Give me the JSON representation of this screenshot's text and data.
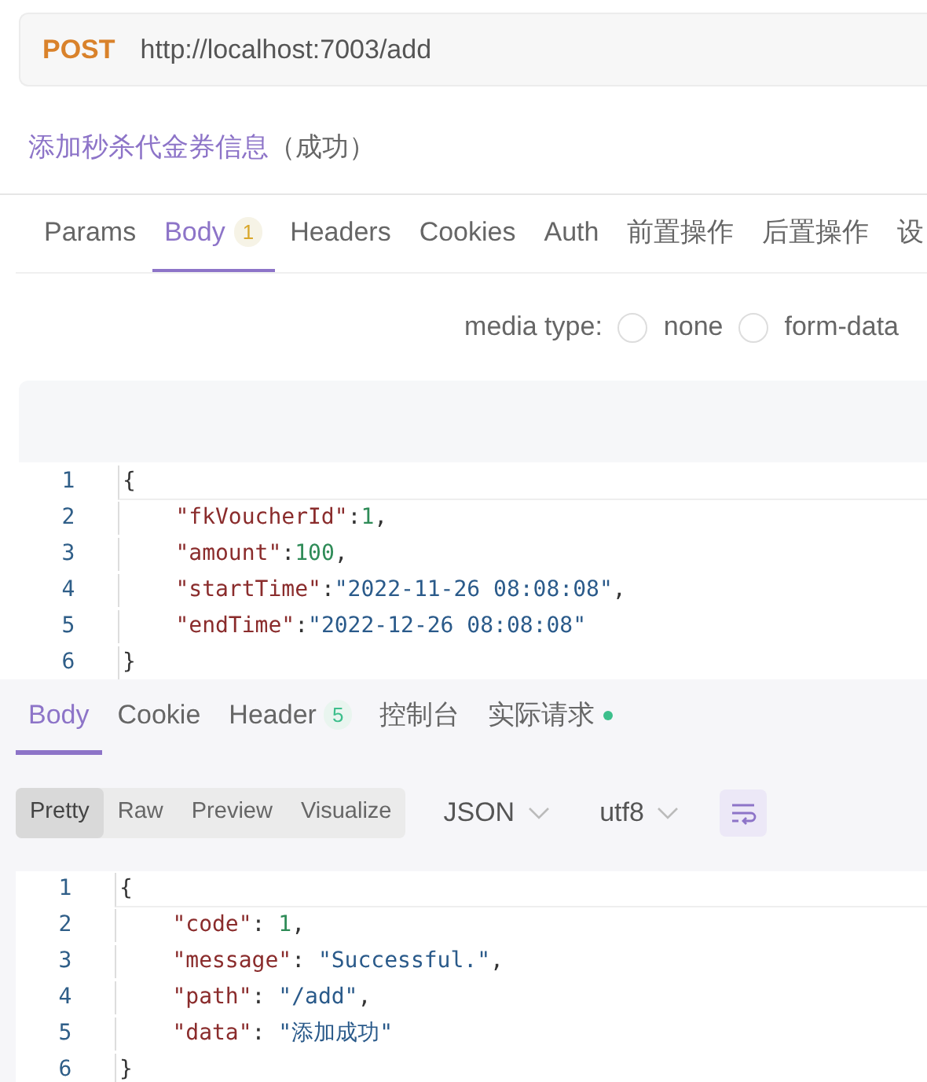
{
  "request": {
    "method": "POST",
    "url": "http://localhost:7003/add"
  },
  "title": {
    "name": "添加秒杀代金券信息",
    "status": "（成功）"
  },
  "request_tabs": [
    {
      "label": "Params",
      "selected": false
    },
    {
      "label": "Body",
      "badge": "1",
      "selected": true
    },
    {
      "label": "Headers",
      "selected": false
    },
    {
      "label": "Cookies",
      "selected": false
    },
    {
      "label": "Auth",
      "selected": false
    },
    {
      "label": "前置操作",
      "selected": false
    },
    {
      "label": "后置操作",
      "selected": false
    },
    {
      "label": "设",
      "selected": false
    }
  ],
  "media_type": {
    "label": "media type:",
    "options": [
      {
        "label": "none",
        "selected": false
      },
      {
        "label": "form-data",
        "selected": false
      }
    ]
  },
  "request_body": [
    {
      "number": "1",
      "tokens": [
        {
          "kind": "punct",
          "text": "{"
        }
      ]
    },
    {
      "number": "2",
      "tokens": [
        {
          "kind": "key",
          "text": "    \"fkVoucherId\""
        },
        {
          "kind": "punct",
          "text": ":"
        },
        {
          "kind": "number",
          "text": "1"
        },
        {
          "kind": "punct",
          "text": ","
        }
      ]
    },
    {
      "number": "3",
      "tokens": [
        {
          "kind": "key",
          "text": "    \"amount\""
        },
        {
          "kind": "punct",
          "text": ":"
        },
        {
          "kind": "number",
          "text": "100"
        },
        {
          "kind": "punct",
          "text": ","
        }
      ]
    },
    {
      "number": "4",
      "tokens": [
        {
          "kind": "key",
          "text": "    \"startTime\""
        },
        {
          "kind": "punct",
          "text": ":"
        },
        {
          "kind": "string",
          "text": "\"2022-11-26 08:08:08\""
        },
        {
          "kind": "punct",
          "text": ","
        }
      ]
    },
    {
      "number": "5",
      "tokens": [
        {
          "kind": "key",
          "text": "    \"endTime\""
        },
        {
          "kind": "punct",
          "text": ":"
        },
        {
          "kind": "string",
          "text": "\"2022-12-26 08:08:08\""
        }
      ]
    },
    {
      "number": "6",
      "tokens": [
        {
          "kind": "punct",
          "text": "}"
        }
      ]
    }
  ],
  "response_tabs": [
    {
      "label": "Body",
      "selected": true
    },
    {
      "label": "Cookie",
      "selected": false
    },
    {
      "label": "Header",
      "badge": "5",
      "selected": false
    },
    {
      "label": "控制台",
      "selected": false
    },
    {
      "label": "实际请求",
      "color": "#3dbf8c",
      "selected": false
    }
  ],
  "view_modes": [
    {
      "label": "Pretty",
      "selected": true
    },
    {
      "label": "Raw",
      "selected": false
    },
    {
      "label": "Preview",
      "selected": false
    },
    {
      "label": "Visualize",
      "selected": false
    }
  ],
  "format": "JSON",
  "encoding": "utf8",
  "response_body": [
    {
      "number": "1",
      "tokens": [
        {
          "kind": "punct",
          "text": "{"
        }
      ]
    },
    {
      "number": "2",
      "tokens": [
        {
          "kind": "key",
          "text": "    \"code\""
        },
        {
          "kind": "punct",
          "text": ": "
        },
        {
          "kind": "number",
          "text": "1"
        },
        {
          "kind": "punct",
          "text": ","
        }
      ]
    },
    {
      "number": "3",
      "tokens": [
        {
          "kind": "key",
          "text": "    \"message\""
        },
        {
          "kind": "punct",
          "text": ": "
        },
        {
          "kind": "string",
          "text": "\"Successful.\""
        },
        {
          "kind": "punct",
          "text": ","
        }
      ]
    },
    {
      "number": "4",
      "tokens": [
        {
          "kind": "key",
          "text": "    \"path\""
        },
        {
          "kind": "punct",
          "text": ": "
        },
        {
          "kind": "string",
          "text": "\"/add\""
        },
        {
          "kind": "punct",
          "text": ","
        }
      ]
    },
    {
      "number": "5",
      "tokens": [
        {
          "kind": "key",
          "text": "    \"data\""
        },
        {
          "kind": "punct",
          "text": ": "
        },
        {
          "kind": "string",
          "text": "\"添加成功\""
        }
      ]
    },
    {
      "number": "6",
      "tokens": [
        {
          "kind": "punct",
          "text": "}"
        }
      ]
    }
  ]
}
